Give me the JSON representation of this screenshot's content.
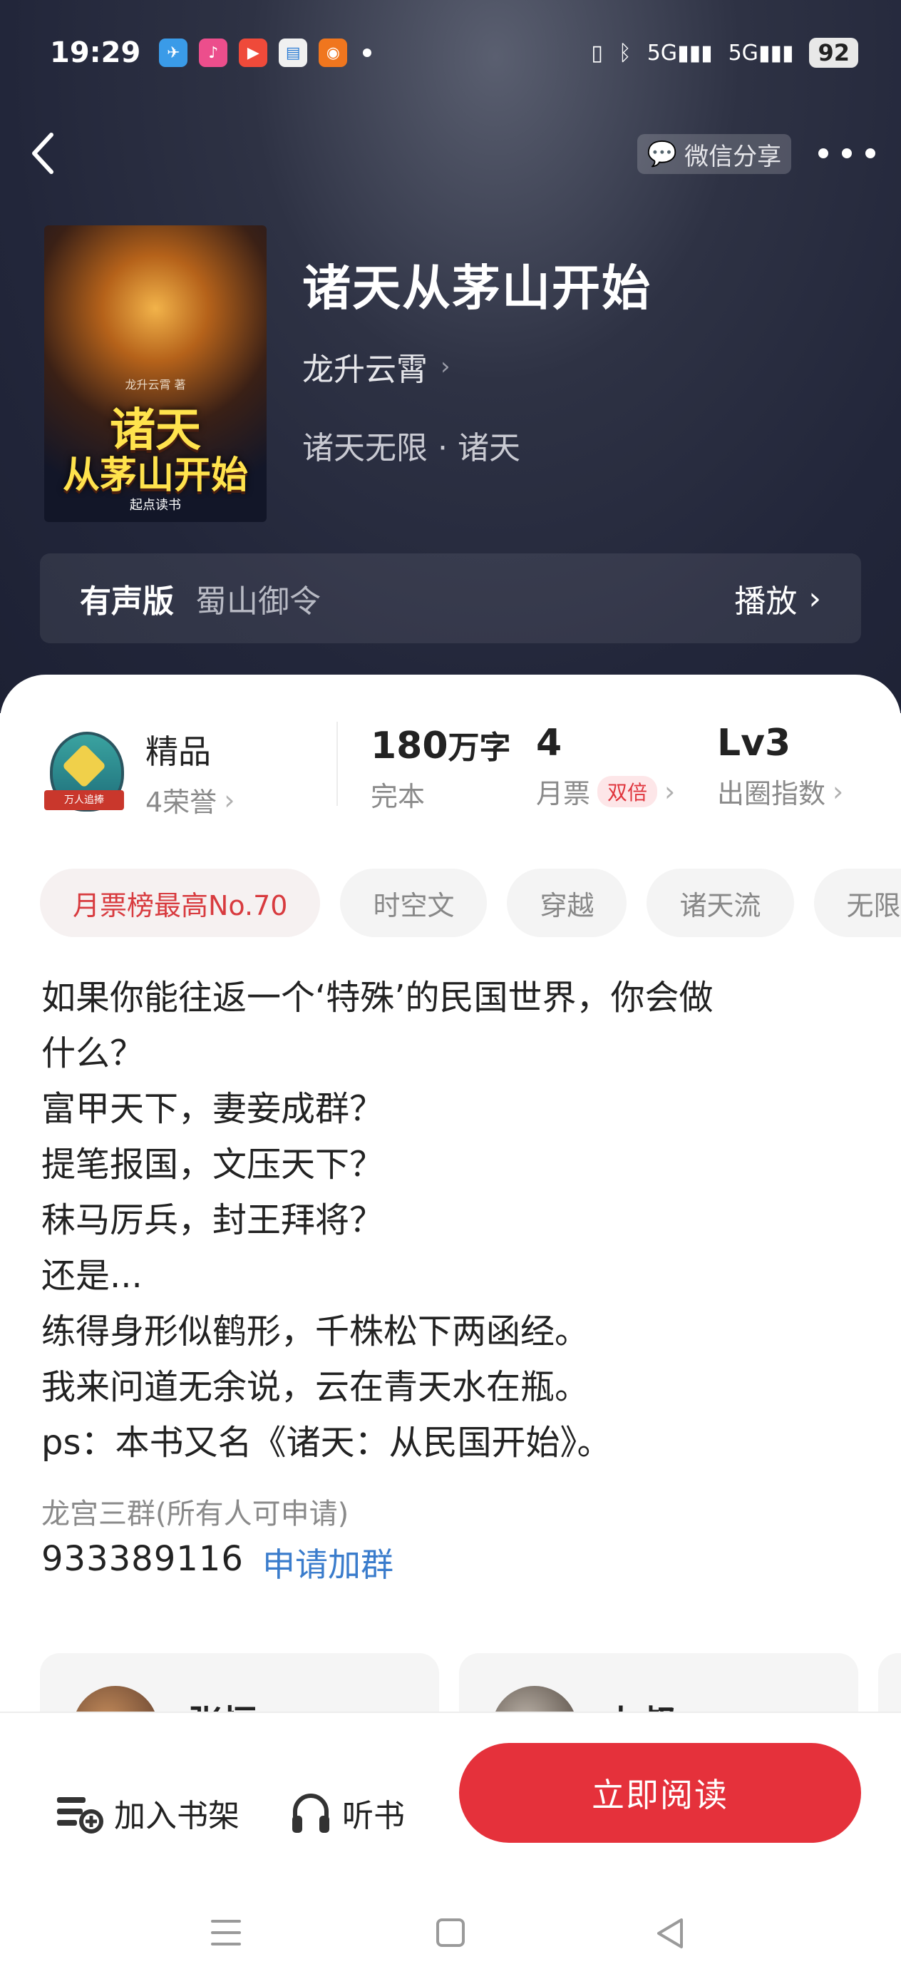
{
  "status_bar": {
    "time": "19:29",
    "battery": "92",
    "signal1": "5G",
    "signal2": "5G"
  },
  "header": {
    "share_label": "微信分享"
  },
  "book": {
    "cover": {
      "author": "龙升云霄 著",
      "title_line1": "诸天",
      "title_line2": "从茅山开始",
      "publisher": "起点读书"
    },
    "title": "诸天从茅山开始",
    "author": "龙升云霄",
    "category": "诸天无限 · 诸天"
  },
  "audio": {
    "label": "有声版",
    "narrator": "蜀山御令",
    "play_label": "播放"
  },
  "stats": {
    "quality": {
      "title": "精品",
      "honors": "4荣誉",
      "badge_text": "万人追捧"
    },
    "words": {
      "value": "180",
      "unit": "万字",
      "label": "完本"
    },
    "monthly_votes": {
      "value": "4",
      "label": "月票",
      "badge": "双倍"
    },
    "level": {
      "value": "Lv3",
      "label": "出圈指数"
    }
  },
  "tags": [
    "月票榜最高No.70",
    "时空文",
    "穿越",
    "诸天流",
    "无限"
  ],
  "description": [
    "如果你能往返一个‘特殊’的民国世界，你会做",
    "什么？",
    "富甲天下，妻妾成群？",
    "提笔报国，文压天下？",
    "秣马厉兵，封王拜将？",
    "还是...",
    "练得身形似鹤形，千株松下两函经。",
    "我来问道无余说，云在青天水在瓶。",
    "ps：本书又名《诸天：从民国开始》。"
  ],
  "group": {
    "label": "龙宫三群(所有人可申请)",
    "number": "933389116",
    "join_label": "申请加群"
  },
  "fans": [
    {
      "name": "张恒"
    },
    {
      "name": "九叔"
    }
  ],
  "actions": {
    "shelf_label": "加入书架",
    "listen_label": "听书",
    "read_label": "立即阅读"
  },
  "colors": {
    "accent": "#e5313b",
    "link": "#3a7ccc",
    "header_bg": "#22263a"
  }
}
